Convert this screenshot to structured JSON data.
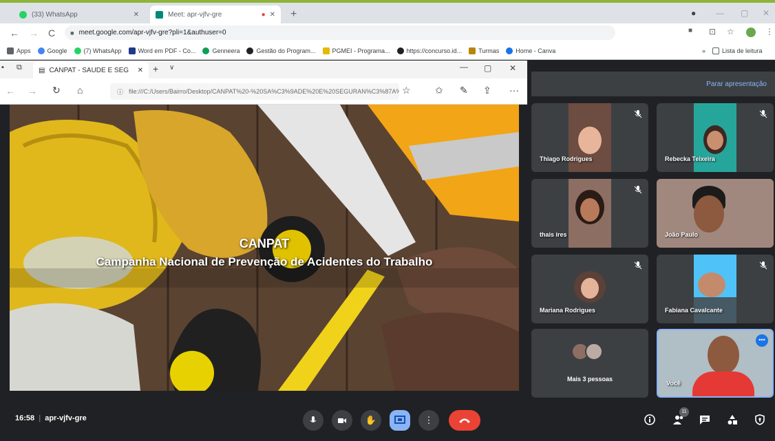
{
  "browser": {
    "tabs": [
      {
        "label": "(33) WhatsApp",
        "favicon_color": "#25d366"
      },
      {
        "label": "Meet: apr-vjfv-gre",
        "favicon_color": "#00897b"
      }
    ],
    "url": "meet.google.com/apr-vjfv-gre?pli=1&authuser=0",
    "bookmarks": [
      {
        "label": "Apps",
        "icon": "apps-grid-icon",
        "color": "#5f6368"
      },
      {
        "label": "Google",
        "icon": "google-icon",
        "color": "#4285f4"
      },
      {
        "label": "(7) WhatsApp",
        "icon": "whatsapp-icon",
        "color": "#25d366"
      },
      {
        "label": "Word em PDF - Co...",
        "icon": "word-pdf-icon",
        "color": "#1e3a8a"
      },
      {
        "label": "Genneera",
        "icon": "genneera-icon",
        "color": "#0f9d58"
      },
      {
        "label": "Gestão do Program...",
        "icon": "gestao-icon",
        "color": "#202124"
      },
      {
        "label": "PGMEI - Programa...",
        "icon": "pgmei-icon",
        "color": "#e6b800"
      },
      {
        "label": "https://concurso.id...",
        "icon": "web-icon",
        "color": "#202124"
      },
      {
        "label": "Turmas",
        "icon": "turmas-icon",
        "color": "#b8860b"
      },
      {
        "label": "Home - Canva",
        "icon": "canva-icon",
        "color": "#1a73e8"
      }
    ],
    "reading_list": "Lista de leitura"
  },
  "edge": {
    "tab_label": "CANPAT - SAUDE E SEG",
    "url": "file:///C:/Users/Bairro/Desktop/CANPAT%20-%20SA%C3%9ADE%20E%20SEGURAN%C3%87A%20"
  },
  "slide": {
    "title": "CANPAT",
    "subtitle": "Campanha Nacional de Prevenção de Acidentes do Trabalho"
  },
  "meet": {
    "stop_presenting": "Parar apresentação",
    "participants": [
      {
        "name": "Thiago Rodrigues",
        "bg": "#6d4c41"
      },
      {
        "name": "Rebecka Teixeira",
        "bg": "#26a69a"
      },
      {
        "name": "thais ires",
        "bg": "#8d6e63"
      },
      {
        "name": "João Paulo",
        "bg": "#a1887f"
      },
      {
        "name": "Mariana Rodrigues",
        "bg": "#3c4043"
      },
      {
        "name": "Fabiana Cavalcante",
        "bg": "#4fc3f7"
      }
    ],
    "more_people": "Mais 3 pessoas",
    "self_name": "Você",
    "time": "16:58",
    "meeting_code": "apr-vjfv-gre",
    "participant_count": "11"
  }
}
